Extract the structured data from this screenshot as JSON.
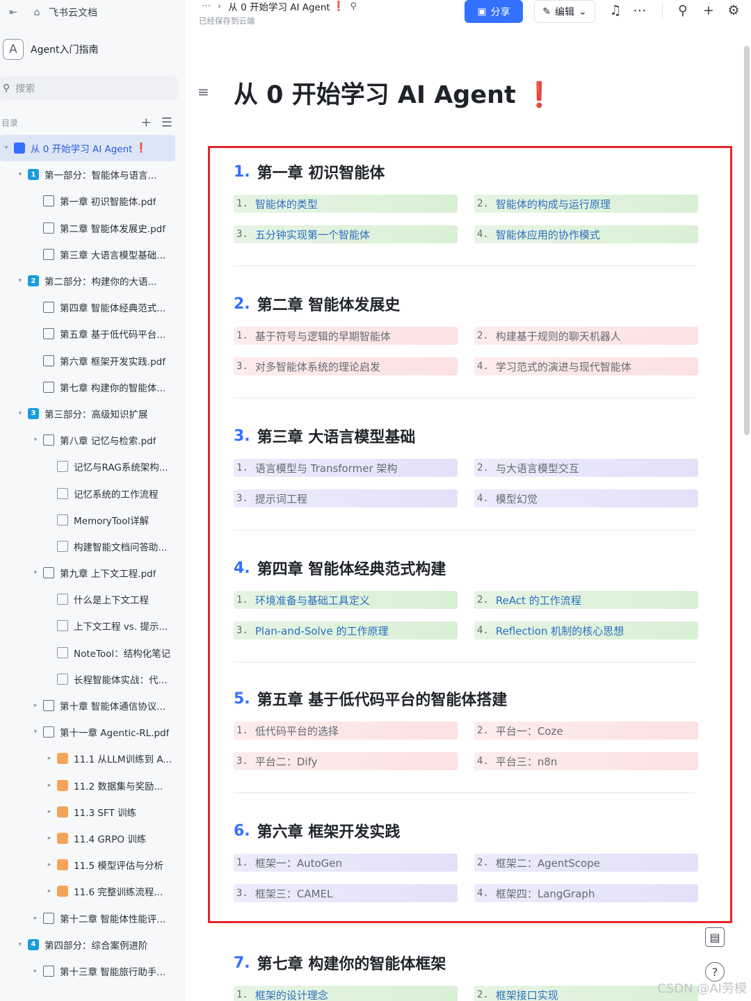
{
  "sidebar": {
    "top_label": "飞书云文档",
    "workspace": {
      "avatar": "A",
      "name": "Agent入门指南"
    },
    "search_placeholder": "搜索",
    "toc_label": "目录",
    "items": [
      {
        "label": "从 0 开始学习 AI Agent",
        "icon": "doc",
        "bang": "❗",
        "level": 0,
        "arrow": "▾",
        "active": true
      },
      {
        "label": "第一部分：智能体与语言...",
        "icon": "num",
        "num": "1",
        "level": 1,
        "arrow": "▾"
      },
      {
        "label": "第一章 初识智能体.pdf",
        "icon": "pdf",
        "level": 2,
        "arrow": ""
      },
      {
        "label": "第二章 智能体发展史.pdf",
        "icon": "pdf",
        "level": 2,
        "arrow": ""
      },
      {
        "label": "第三章 大语言模型基础...",
        "icon": "pdf",
        "level": 2,
        "arrow": ""
      },
      {
        "label": "第二部分：构建你的大语...",
        "icon": "num",
        "num": "2",
        "level": 1,
        "arrow": "▾"
      },
      {
        "label": "第四章 智能体经典范式...",
        "icon": "pdf",
        "level": 2,
        "arrow": ""
      },
      {
        "label": "第五章 基于低代码平台...",
        "icon": "pdf",
        "level": 2,
        "arrow": ""
      },
      {
        "label": "第六章 框架开发实践.pdf",
        "icon": "pdf",
        "level": 2,
        "arrow": ""
      },
      {
        "label": "第七章 构建你的智能体...",
        "icon": "pdf",
        "level": 2,
        "arrow": ""
      },
      {
        "label": "第三部分：高级知识扩展",
        "icon": "num",
        "num": "3",
        "level": 1,
        "arrow": "▾"
      },
      {
        "label": "第八章 记忆与检索.pdf",
        "icon": "pdf",
        "level": 2,
        "arrow": "▾"
      },
      {
        "label": "记忆与RAG系统架构...",
        "icon": "page",
        "level": 3,
        "arrow": ""
      },
      {
        "label": "记忆系统的工作流程",
        "icon": "page",
        "level": 3,
        "arrow": ""
      },
      {
        "label": "MemoryTool详解",
        "icon": "page",
        "level": 3,
        "arrow": ""
      },
      {
        "label": "构建智能文档问答助...",
        "icon": "page",
        "level": 3,
        "arrow": ""
      },
      {
        "label": "第九章 上下文工程.pdf",
        "icon": "pdf",
        "level": 2,
        "arrow": "▾"
      },
      {
        "label": "什么是上下文工程",
        "icon": "page",
        "level": 3,
        "arrow": ""
      },
      {
        "label": "上下文工程 vs. 提示...",
        "icon": "page",
        "level": 3,
        "arrow": ""
      },
      {
        "label": "NoteTool：结构化笔记",
        "icon": "page",
        "level": 3,
        "arrow": ""
      },
      {
        "label": "长程智能体实战：代...",
        "icon": "page",
        "level": 3,
        "arrow": ""
      },
      {
        "label": "第十章 智能体通信协议...",
        "icon": "pdf",
        "level": 2,
        "arrow": "▸"
      },
      {
        "label": "第十一章 Agentic-RL.pdf",
        "icon": "pdf",
        "level": 2,
        "arrow": "▾"
      },
      {
        "label": "11.1 从LLM训练到 A...",
        "icon": "orange",
        "level": 3,
        "arrow": "▸"
      },
      {
        "label": "11.2 数据集与奖励...",
        "icon": "orange",
        "level": 3,
        "arrow": "▸"
      },
      {
        "label": "11.3 SFT 训练",
        "icon": "orange",
        "level": 3,
        "arrow": "▸"
      },
      {
        "label": "11.4 GRPO 训练",
        "icon": "orange",
        "level": 3,
        "arrow": "▸"
      },
      {
        "label": "11.5 模型评估与分析",
        "icon": "orange",
        "level": 3,
        "arrow": "▸"
      },
      {
        "label": "11.6 完整训练流程...",
        "icon": "orange",
        "level": 3,
        "arrow": "▸"
      },
      {
        "label": "第十二章 智能体性能评...",
        "icon": "pdf",
        "level": 2,
        "arrow": "▸"
      },
      {
        "label": "第四部分：综合案例进阶",
        "icon": "num",
        "num": "4",
        "level": 1,
        "arrow": "▾"
      },
      {
        "label": "第十三章 智能旅行助手...",
        "icon": "pdf",
        "level": 2,
        "arrow": "▸"
      }
    ]
  },
  "topbar": {
    "breadcrumb_more": "···",
    "breadcrumb_sep": "›",
    "breadcrumb_title": "从 0 开始学习 AI Agent",
    "breadcrumb_bang": "❗",
    "saved_status": "已经保存到云端",
    "share_label": "分享",
    "edit_label": "编辑"
  },
  "document": {
    "title": "从 0 开始学习 AI Agent",
    "title_bang": "❗",
    "chapters": [
      {
        "no": "1.",
        "title": "第一章 初识智能体",
        "color": "g",
        "items": [
          {
            "n": "1.",
            "t": "智能体的类型"
          },
          {
            "n": "2.",
            "t": "智能体的构成与运行原理"
          },
          {
            "n": "3.",
            "t": "五分钟实现第一个智能体"
          },
          {
            "n": "4.",
            "t": "智能体应用的协作模式"
          }
        ]
      },
      {
        "no": "2.",
        "title": "第二章 智能体发展史",
        "color": "r",
        "items": [
          {
            "n": "1.",
            "t": "基于符号与逻辑的早期智能体"
          },
          {
            "n": "2.",
            "t": "构建基于规则的聊天机器人"
          },
          {
            "n": "3.",
            "t": "对多智能体系统的理论启发"
          },
          {
            "n": "4.",
            "t": "学习范式的演进与现代智能体"
          }
        ]
      },
      {
        "no": "3.",
        "title": "第三章 大语言模型基础",
        "color": "p",
        "items": [
          {
            "n": "1.",
            "t": "语言模型与 Transformer 架构"
          },
          {
            "n": "2.",
            "t": "与大语言模型交互"
          },
          {
            "n": "3.",
            "t": "提示词工程"
          },
          {
            "n": "4.",
            "t": "模型幻觉"
          }
        ]
      },
      {
        "no": "4.",
        "title": "第四章 智能体经典范式构建",
        "color": "g",
        "items": [
          {
            "n": "1.",
            "t": "环境准备与基础工具定义"
          },
          {
            "n": "2.",
            "t": "ReAct 的工作流程"
          },
          {
            "n": "3.",
            "t": "Plan-and-Solve 的工作原理"
          },
          {
            "n": "4.",
            "t": "Reflection 机制的核心思想"
          }
        ]
      },
      {
        "no": "5.",
        "title": "第五章 基于低代码平台的智能体搭建",
        "color": "r",
        "items": [
          {
            "n": "1.",
            "t": "低代码平台的选择"
          },
          {
            "n": "2.",
            "t": "平台一：Coze"
          },
          {
            "n": "3.",
            "t": "平台二：Dify"
          },
          {
            "n": "4.",
            "t": "平台三：n8n"
          }
        ]
      },
      {
        "no": "6.",
        "title": "第六章 框架开发实践",
        "color": "p",
        "items": [
          {
            "n": "1.",
            "t": "框架一：AutoGen"
          },
          {
            "n": "2.",
            "t": "框架二：AgentScope"
          },
          {
            "n": "3.",
            "t": "框架三：CAMEL"
          },
          {
            "n": "4.",
            "t": "框架四：LangGraph"
          }
        ]
      },
      {
        "no": "7.",
        "title": "第七章 构建你的智能体框架",
        "color": "g",
        "items": [
          {
            "n": "1.",
            "t": "框架的设计理念"
          },
          {
            "n": "2.",
            "t": "框架接口实现"
          }
        ]
      }
    ]
  },
  "watermark": "CSDN @AI劳模",
  "colors": {
    "accent": "#3370ff",
    "highlight_border": "#e3242b",
    "bang": "#f54a45"
  }
}
